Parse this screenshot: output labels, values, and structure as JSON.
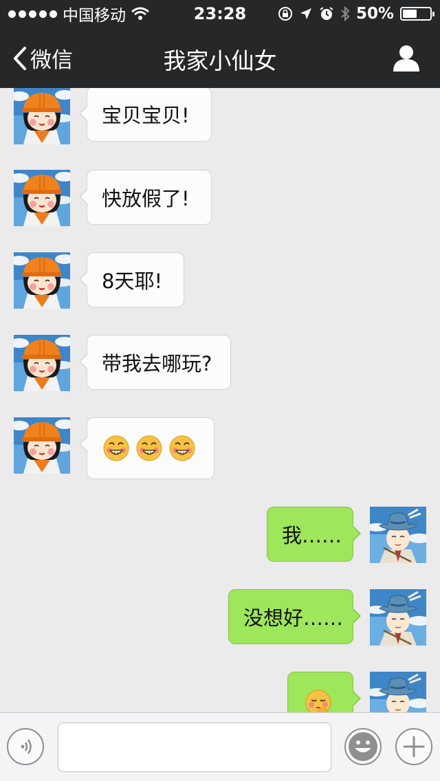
{
  "status_bar": {
    "carrier": "中国移动",
    "time": "23:28",
    "battery": "50%"
  },
  "nav": {
    "back_label": "微信",
    "title": "我家小仙女"
  },
  "messages": [
    {
      "side": "in",
      "text": "宝贝宝贝!"
    },
    {
      "side": "in",
      "text": "快放假了!"
    },
    {
      "side": "in",
      "text": "8天耶!"
    },
    {
      "side": "in",
      "text": "带我去哪玩?"
    },
    {
      "side": "in",
      "emoji": "grinning-blush-emoji",
      "emoji_count": 3
    },
    {
      "side": "out",
      "text": "我……"
    },
    {
      "side": "out",
      "text": "没想好……"
    },
    {
      "side": "out",
      "emoji": "shy-emoji",
      "emoji_count": 1
    }
  ],
  "icons": {
    "back": "chevron-left-icon",
    "profile": "person-icon",
    "voice": "voice-icon",
    "emoji_button": "smiley-icon",
    "more": "plus-icon"
  },
  "colors": {
    "bar_bg": "#262729",
    "chat_bg": "#ebebeb",
    "bubble_out": "#9ee65a",
    "bubble_in": "#fcfcfc"
  },
  "input": {
    "value": ""
  }
}
